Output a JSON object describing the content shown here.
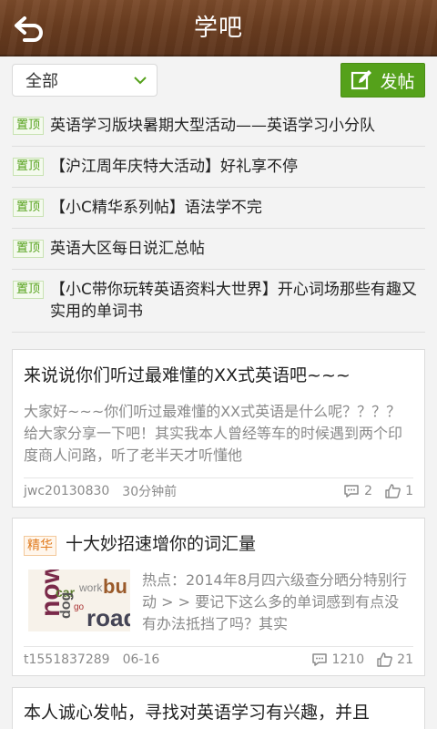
{
  "header": {
    "title": "学吧"
  },
  "filter": {
    "selected": "全部",
    "post_label": "发帖"
  },
  "pinned": [
    {
      "tag": "置顶",
      "text": "英语学习版块暑期大型活动——英语学习小分队"
    },
    {
      "tag": "置顶",
      "text": "【沪江周年庆特大活动】好礼享不停"
    },
    {
      "tag": "置顶",
      "text": "【小C精华系列帖】语法学不完"
    },
    {
      "tag": "置顶",
      "text": "英语大区每日说汇总帖"
    },
    {
      "tag": "置顶",
      "text": "【小C带你玩转英语资料大世界】开心词场那些有趣又实用的单词书"
    }
  ],
  "posts": [
    {
      "title": "来说说你们听过最难懂的XX式英语吧~~~",
      "body": "大家好~~~你们听过最难懂的XX式英语是什么呢？？？？给大家分享一下吧！其实我本人曾经等车的时候遇到两个印度商人问路，听了老半天才听懂他",
      "author": "jwc20130830",
      "time": "30分钟前",
      "comments": "2",
      "likes": "1"
    },
    {
      "tag": "精华",
      "title": "十大妙招速增你的词汇量",
      "body": "热点：2014年8月四六级查分晒分特别行动 > > 要记下这么多的单词感到有点没有办法抵挡了吗？其实",
      "author": "t1551837289",
      "time": "06-16",
      "comments": "1210",
      "likes": "21"
    },
    {
      "title": "本人诚心发帖，寻找对英语学习有兴趣，并且"
    }
  ],
  "colors": {
    "accent": "#55a11b",
    "header": "#6a3d20",
    "essence": "#e07b1f"
  }
}
